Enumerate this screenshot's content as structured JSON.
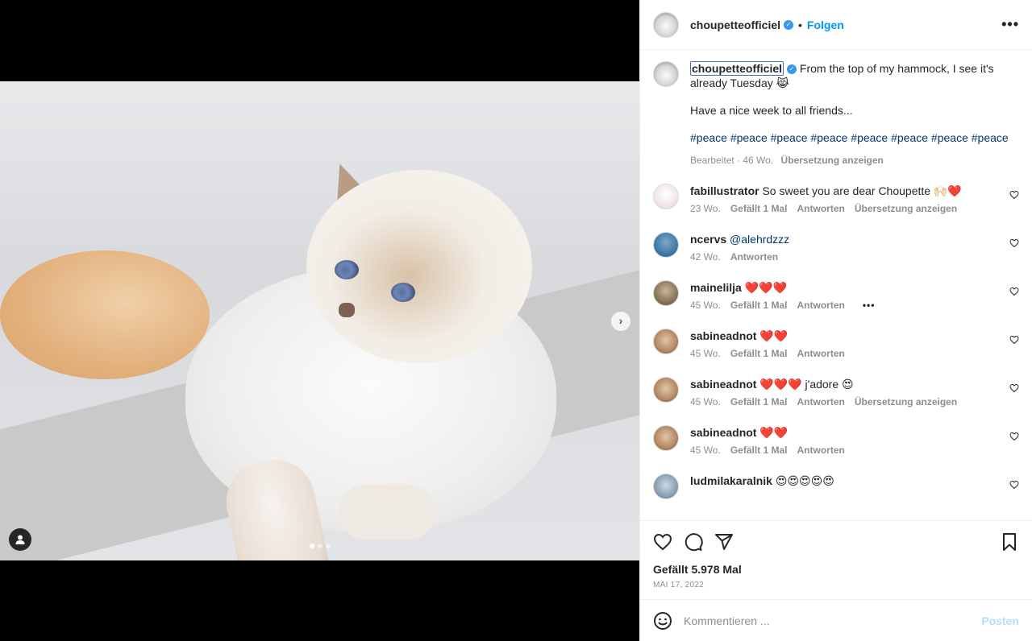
{
  "header": {
    "username": "choupetteofficiel",
    "separator": "•",
    "follow_label": "Folgen",
    "more_label": "•••"
  },
  "caption": {
    "username": "choupetteofficiel",
    "line1": "From the top of my hammock, I see it's already Tuesday 😹",
    "line2": "Have a nice week to all friends...",
    "hashtags": "#peace #peace #peace #peace #peace #peace #peace #peace",
    "edited": "Bearbeitet",
    "age": "46 Wo.",
    "translate": "Übersetzung anzeigen"
  },
  "comments": [
    {
      "user": "fabillustrator",
      "text": "So sweet you are dear Choupette 🙌🏻❤️",
      "age": "23 Wo.",
      "likes": "Gefällt 1 Mal",
      "reply": "Antworten",
      "translate": "Übersetzung anzeigen"
    },
    {
      "user": "ncervs",
      "mention": "@alehrdzzz",
      "age": "42 Wo.",
      "reply": "Antworten"
    },
    {
      "user": "mainelilja",
      "text": "❤️❤️❤️",
      "age": "45 Wo.",
      "likes": "Gefällt 1 Mal",
      "reply": "Antworten",
      "more": "•••"
    },
    {
      "user": "sabineadnot",
      "text": "❤️❤️",
      "age": "45 Wo.",
      "likes": "Gefällt 1 Mal",
      "reply": "Antworten"
    },
    {
      "user": "sabineadnot",
      "text": "❤️❤️❤️ j'adore 😍",
      "age": "45 Wo.",
      "likes": "Gefällt 1 Mal",
      "reply": "Antworten",
      "translate": "Übersetzung anzeigen"
    },
    {
      "user": "sabineadnot",
      "text": "❤️❤️",
      "age": "45 Wo.",
      "likes": "Gefällt 1 Mal",
      "reply": "Antworten"
    },
    {
      "user": "ludmilakaralnik",
      "text": "😍😍😍😍😍"
    }
  ],
  "actions": {
    "likes": "Gefällt 5.978 Mal",
    "date": "MAI 17, 2022"
  },
  "compose": {
    "placeholder": "Kommentieren ...",
    "post_label": "Posten"
  },
  "media": {
    "next_label": "›",
    "carousel_total": 3,
    "carousel_active": 1
  },
  "colors": {
    "accent": "#0095f6",
    "link": "#00376b",
    "muted": "#8e8e8e"
  }
}
